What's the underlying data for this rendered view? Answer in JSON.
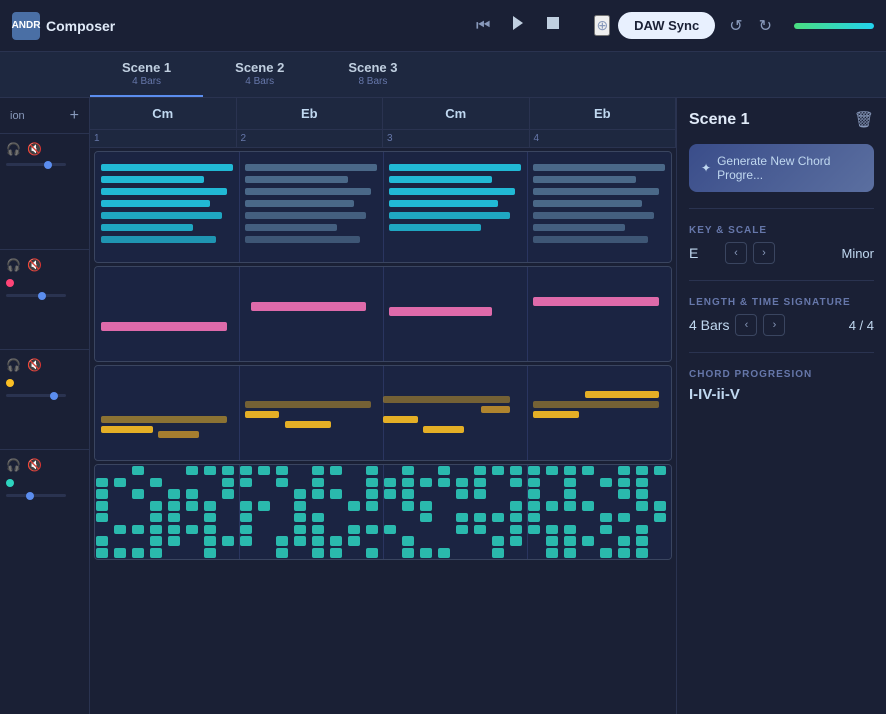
{
  "app": {
    "logo_abbr": "ANDR",
    "title": "Composer"
  },
  "topbar": {
    "prev_label": "⏮",
    "play_label": "▶",
    "stop_label": "■",
    "daw_sync_label": "DAW Sync",
    "undo_label": "↺",
    "redo_label": "↻",
    "expand_label": "⊕"
  },
  "scenes": [
    {
      "name": "Scene 1",
      "bars": "4 Bars",
      "active": true
    },
    {
      "name": "Scene 2",
      "bars": "4 Bars",
      "active": false
    },
    {
      "name": "Scene 3",
      "bars": "8 Bars",
      "active": false
    }
  ],
  "sidebar": {
    "label": "ion",
    "add_label": "+"
  },
  "chords": [
    "Cm",
    "Eb",
    "Cm",
    "Eb"
  ],
  "bar_numbers": [
    "1",
    "2",
    "3",
    "4"
  ],
  "right_panel": {
    "title": "Scene 1",
    "delete_icon": "🗑",
    "generate_label": "Generate New Chord Progre...",
    "key_scale_label": "KEY & SCALE",
    "key_value": "E",
    "scale_value": "Minor",
    "length_time_label": "LENGTH & TIME SIGNATURE",
    "length_value": "4 Bars",
    "time_sig_value": "4 / 4",
    "chord_prog_label": "CHORD PROGRESION",
    "chord_prog_value": "I-IV-ii-V"
  }
}
